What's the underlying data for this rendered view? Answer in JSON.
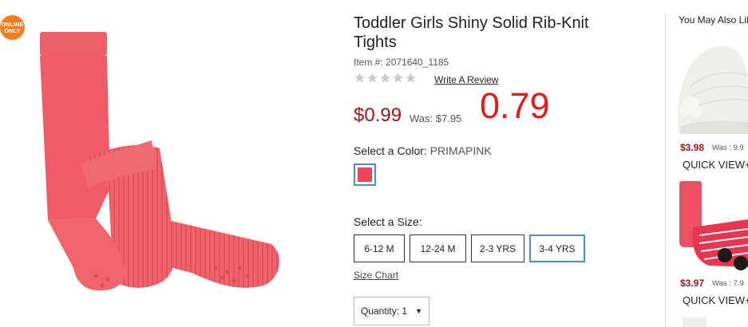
{
  "badge": {
    "text": "ONLINE ONLY",
    "color": "#f47d20"
  },
  "product": {
    "title": "Toddler Girls Shiny Solid Rib-Knit Tights",
    "item_number": "Item #: 2071640_1185",
    "rating_stars": 0,
    "review_link": "Write A Review",
    "price": "$0.99",
    "was_price": "Was: $7.95",
    "annotation": "0.79"
  },
  "color": {
    "label": "Select a Color:",
    "value": "PRIMAPINK",
    "swatch_hex": "#f0445a"
  },
  "size": {
    "label": "Select a Size:",
    "options": [
      "6-12 M",
      "12-24 M",
      "2-3 YRS",
      "3-4 YRS"
    ],
    "selected": "3-4 YRS",
    "chart_link": "Size Chart"
  },
  "quantity": {
    "label": "Quantity: 1",
    "arrow": "▼"
  },
  "rail": {
    "title": "You May Also Lik",
    "items": [
      {
        "price": "$3.98",
        "was": "Was : 9.9",
        "quick_view": "QUICK VIEW+"
      },
      {
        "price": "$3.97",
        "was": "Was : 7.9",
        "quick_view": "QUICK VIEW+"
      }
    ]
  },
  "colors": {
    "price_red": "#a5141b",
    "annotation_red": "#e41b1b",
    "accent_blue": "#4a90c8"
  }
}
